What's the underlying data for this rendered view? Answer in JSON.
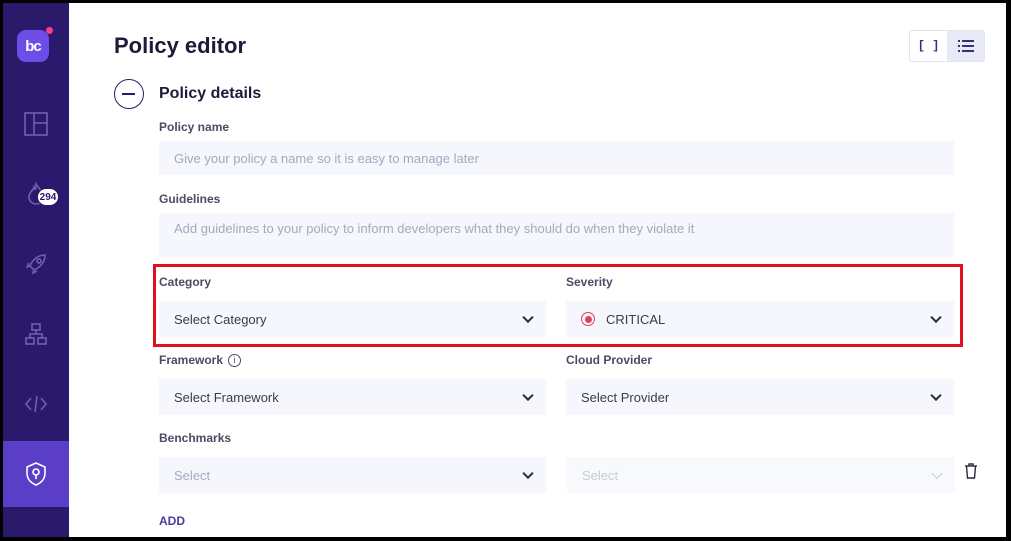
{
  "app": {
    "logo_text": "bc"
  },
  "sidebar": {
    "items": [
      {
        "name": "dashboard",
        "icon": "dashboard-icon"
      },
      {
        "name": "incidents",
        "icon": "flame-icon",
        "badge": "294"
      },
      {
        "name": "deploy",
        "icon": "rocket-icon"
      },
      {
        "name": "resources",
        "icon": "hierarchy-icon"
      },
      {
        "name": "code",
        "icon": "code-icon"
      },
      {
        "name": "policies",
        "icon": "shield-icon",
        "active": true
      }
    ]
  },
  "header": {
    "title": "Policy editor"
  },
  "section": {
    "title": "Policy details"
  },
  "form": {
    "policy_name": {
      "label": "Policy name",
      "placeholder": "Give your policy a name so it is easy to manage later"
    },
    "guidelines": {
      "label": "Guidelines",
      "placeholder": "Add guidelines to your policy to inform developers what they should do when they violate it"
    },
    "category": {
      "label": "Category",
      "value": "Select Category"
    },
    "severity": {
      "label": "Severity",
      "value": "CRITICAL",
      "color": "#e0405a"
    },
    "framework": {
      "label": "Framework",
      "value": "Select Framework"
    },
    "cloud_provider": {
      "label": "Cloud Provider",
      "value": "Select Provider"
    },
    "benchmarks": {
      "label": "Benchmarks",
      "select1": "Select",
      "select2": "Select"
    },
    "add_label": "ADD"
  },
  "colors": {
    "sidebar": "#2b1a6b",
    "accent": "#5a3ec8",
    "highlight": "#e0101e"
  }
}
